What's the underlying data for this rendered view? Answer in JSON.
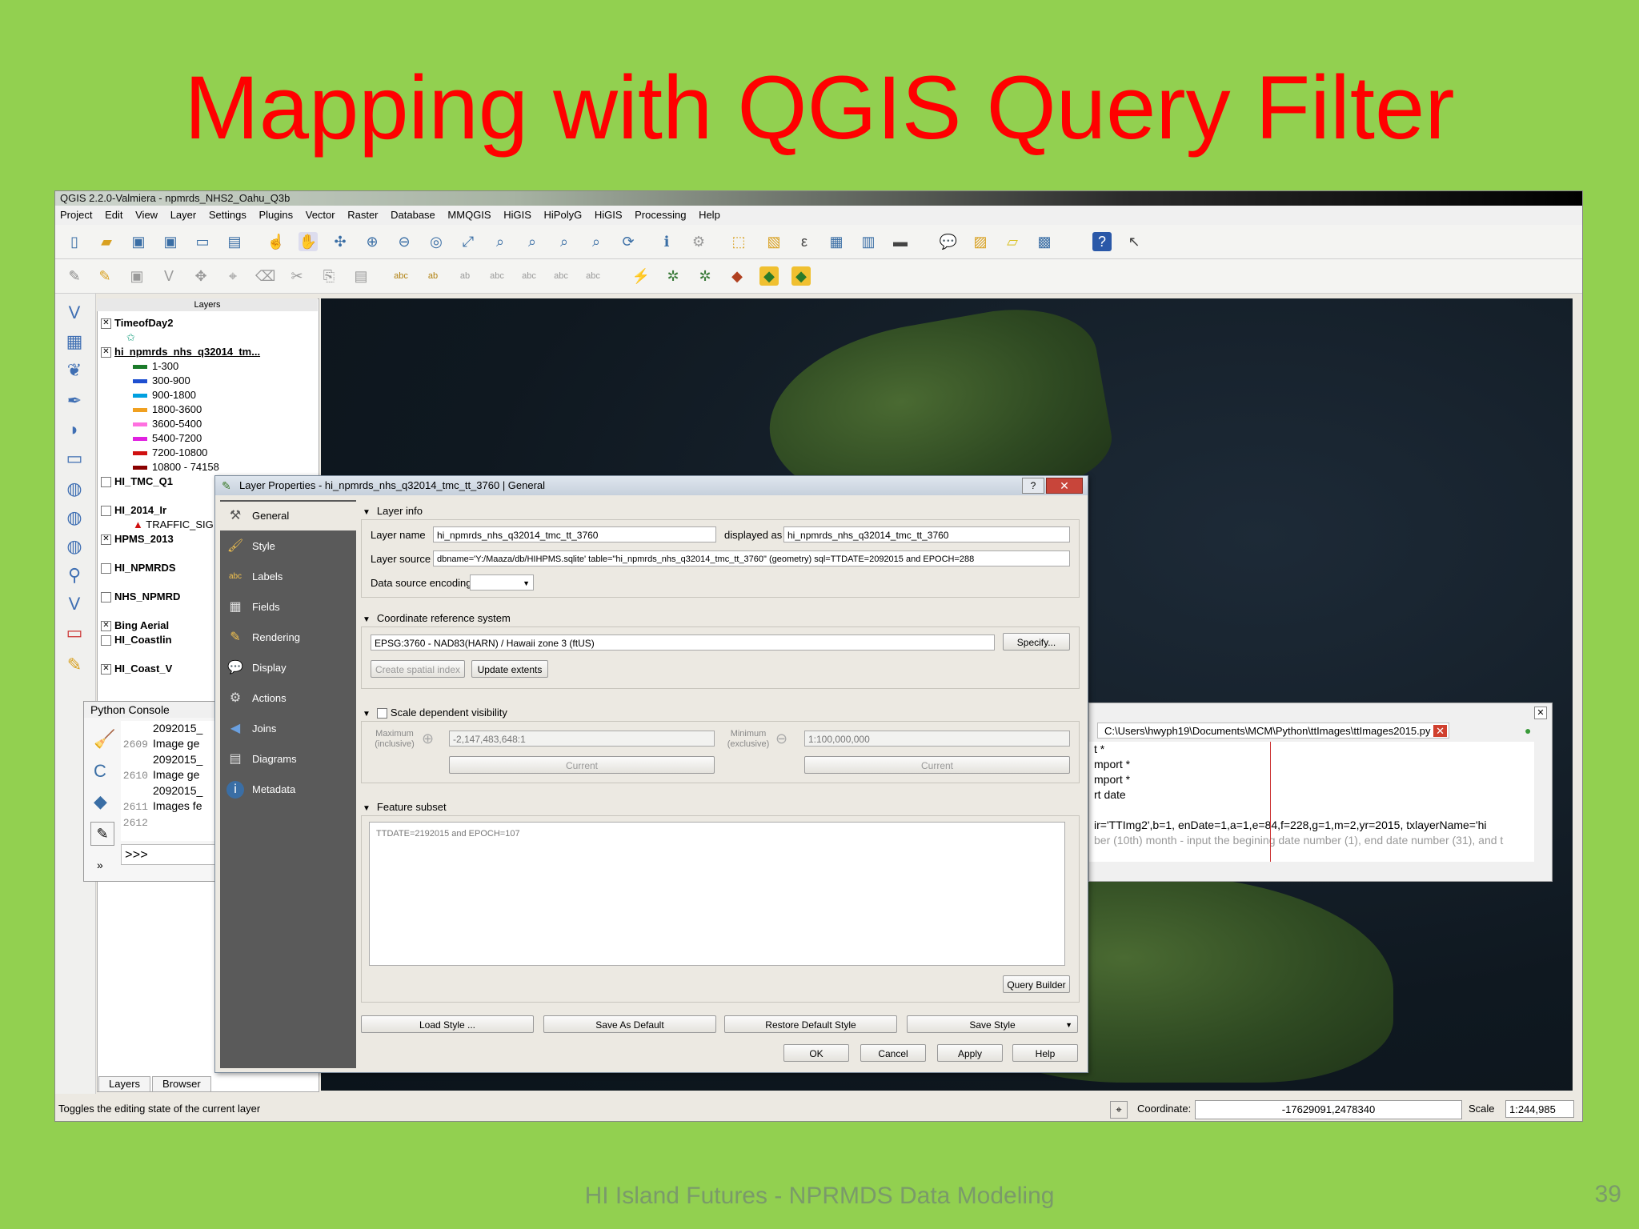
{
  "slide": {
    "title": "Mapping with QGIS Query Filter",
    "footer": "HI Island Futures - NPRMDS Data Modeling",
    "page_number": "39"
  },
  "qgis": {
    "window_title": "QGIS 2.2.0-Valmiera - npmrds_NHS2_Oahu_Q3b",
    "menu": [
      "Project",
      "Edit",
      "View",
      "Layer",
      "Settings",
      "Plugins",
      "Vector",
      "Raster",
      "Database",
      "MMQGIS",
      "HiGIS",
      "HiPolyG",
      "HiGIS",
      "Processing",
      "Help"
    ],
    "layers_panel_title": "Layers",
    "layers": [
      {
        "name": "TimeofDay2",
        "bold": true
      },
      {
        "name": "hi_npmrds_nhs_q32014_tm...",
        "bold": true
      },
      {
        "name": "1-300"
      },
      {
        "name": "300-900"
      },
      {
        "name": "900-1800"
      },
      {
        "name": "1800-3600"
      },
      {
        "name": "3600-5400"
      },
      {
        "name": "5400-7200"
      },
      {
        "name": "7200-10800"
      },
      {
        "name": "10800 - 74158"
      },
      {
        "name": "HI_TMC_Q1",
        "bold": true
      },
      {
        "name": "HI_2014_Ir",
        "bold": true
      },
      {
        "name": "TRAFFIC_SIG"
      },
      {
        "name": "HPMS_2013",
        "bold": true
      },
      {
        "name": "HI_NPMRDS",
        "bold": true
      },
      {
        "name": "NHS_NPMRD",
        "bold": true
      },
      {
        "name": "Bing Aerial",
        "bold": true
      },
      {
        "name": "HI_Coastlin",
        "bold": true
      },
      {
        "name": "HI_Coast_V",
        "bold": true
      }
    ],
    "legend_colors": [
      "#1a7a2a",
      "#1e4fd0",
      "#00a0e0",
      "#f0a020",
      "#ff70e0",
      "#e020e0",
      "#d01010",
      "#8a0000"
    ],
    "layers_tabs": [
      "Layers",
      "Browser"
    ],
    "status_message": "Toggles the editing state of the current layer",
    "coordinate_label": "Coordinate:",
    "coordinate_value": "-17629091,2478340",
    "scale_label": "Scale",
    "scale_value": "1:244,985"
  },
  "python_console": {
    "title": "Python Console",
    "lines": [
      {
        "num": "",
        "text": "2092015_"
      },
      {
        "num": "2609",
        "text": "Image ge"
      },
      {
        "num": "",
        "text": "2092015_"
      },
      {
        "num": "2610",
        "text": "Image ge"
      },
      {
        "num": "",
        "text": "2092015_"
      },
      {
        "num": "2611",
        "text": "Images fe"
      },
      {
        "num": "2612",
        "text": ""
      }
    ],
    "prompt": ">>>"
  },
  "editor": {
    "file_path": "C:\\Users\\hwyph19\\Documents\\MCM\\Python\\ttImages\\ttImages2015.py",
    "code_lines": [
      "t *",
      "mport *",
      "mport *",
      "rt date",
      "",
      "ir='TTImg2',b=1, enDate=1,a=1,e=84,f=228,g=1,m=2,yr=2015, txlayerName='hi",
      "ber (10th) month - input the begining date number (1), end date number (31), and t"
    ]
  },
  "dialog": {
    "title": "Layer Properties - hi_npmrds_nhs_q32014_tmc_tt_3760 | General",
    "help_label": "?",
    "close_label": "✕",
    "nav": [
      "General",
      "Style",
      "Labels",
      "Fields",
      "Rendering",
      "Display",
      "Actions",
      "Joins",
      "Diagrams",
      "Metadata"
    ],
    "layer_info": {
      "heading": "Layer info",
      "layer_name_label": "Layer name",
      "layer_name_value": "hi_npmrds_nhs_q32014_tmc_tt_3760",
      "displayed_as_label": "displayed as",
      "displayed_as_value": "hi_npmrds_nhs_q32014_tmc_tt_3760",
      "layer_source_label": "Layer source",
      "layer_source_value": "dbname='Y:/Maaza/db/HIHPMS.sqlite' table=\"hi_npmrds_nhs_q32014_tmc_tt_3760\" (geometry) sql=TTDATE=2092015 and EPOCH=288",
      "encoding_label": "Data source encoding"
    },
    "crs": {
      "heading": "Coordinate reference system",
      "value": "EPSG:3760 - NAD83(HARN) / Hawaii zone 3 (ftUS)",
      "specify": "Specify...",
      "create_index": "Create spatial index",
      "update_extents": "Update extents"
    },
    "scale": {
      "heading": "Scale dependent visibility",
      "max_label": "Maximum (inclusive)",
      "max_value": "-2,147,483,648:1",
      "min_label": "Minimum (exclusive)",
      "min_value": "1:100,000,000",
      "current": "Current"
    },
    "subset": {
      "heading": "Feature subset",
      "text": "TTDATE=2192015 and EPOCH=107",
      "query_builder": "Query Builder"
    },
    "buttons": {
      "load_style": "Load Style ...",
      "save_default": "Save As Default",
      "restore_default": "Restore Default Style",
      "save_style": "Save Style",
      "ok": "OK",
      "cancel": "Cancel",
      "apply": "Apply",
      "help": "Help"
    }
  }
}
